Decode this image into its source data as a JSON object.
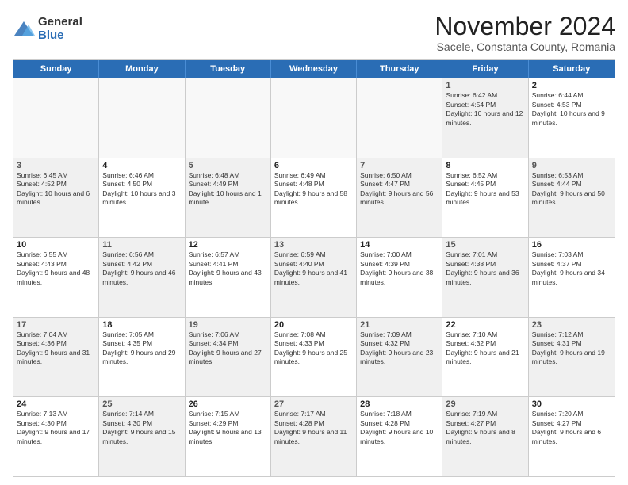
{
  "logo": {
    "general": "General",
    "blue": "Blue"
  },
  "header": {
    "month": "November 2024",
    "location": "Sacele, Constanta County, Romania"
  },
  "weekdays": [
    "Sunday",
    "Monday",
    "Tuesday",
    "Wednesday",
    "Thursday",
    "Friday",
    "Saturday"
  ],
  "rows": [
    [
      {
        "day": "",
        "text": "",
        "empty": true
      },
      {
        "day": "",
        "text": "",
        "empty": true
      },
      {
        "day": "",
        "text": "",
        "empty": true
      },
      {
        "day": "",
        "text": "",
        "empty": true
      },
      {
        "day": "",
        "text": "",
        "empty": true
      },
      {
        "day": "1",
        "text": "Sunrise: 6:42 AM\nSunset: 4:54 PM\nDaylight: 10 hours and 12 minutes.",
        "shaded": true
      },
      {
        "day": "2",
        "text": "Sunrise: 6:44 AM\nSunset: 4:53 PM\nDaylight: 10 hours and 9 minutes.",
        "shaded": false
      }
    ],
    [
      {
        "day": "3",
        "text": "Sunrise: 6:45 AM\nSunset: 4:52 PM\nDaylight: 10 hours and 6 minutes.",
        "shaded": true
      },
      {
        "day": "4",
        "text": "Sunrise: 6:46 AM\nSunset: 4:50 PM\nDaylight: 10 hours and 3 minutes.",
        "shaded": false
      },
      {
        "day": "5",
        "text": "Sunrise: 6:48 AM\nSunset: 4:49 PM\nDaylight: 10 hours and 1 minute.",
        "shaded": true
      },
      {
        "day": "6",
        "text": "Sunrise: 6:49 AM\nSunset: 4:48 PM\nDaylight: 9 hours and 58 minutes.",
        "shaded": false
      },
      {
        "day": "7",
        "text": "Sunrise: 6:50 AM\nSunset: 4:47 PM\nDaylight: 9 hours and 56 minutes.",
        "shaded": true
      },
      {
        "day": "8",
        "text": "Sunrise: 6:52 AM\nSunset: 4:45 PM\nDaylight: 9 hours and 53 minutes.",
        "shaded": false
      },
      {
        "day": "9",
        "text": "Sunrise: 6:53 AM\nSunset: 4:44 PM\nDaylight: 9 hours and 50 minutes.",
        "shaded": true
      }
    ],
    [
      {
        "day": "10",
        "text": "Sunrise: 6:55 AM\nSunset: 4:43 PM\nDaylight: 9 hours and 48 minutes.",
        "shaded": false
      },
      {
        "day": "11",
        "text": "Sunrise: 6:56 AM\nSunset: 4:42 PM\nDaylight: 9 hours and 46 minutes.",
        "shaded": true
      },
      {
        "day": "12",
        "text": "Sunrise: 6:57 AM\nSunset: 4:41 PM\nDaylight: 9 hours and 43 minutes.",
        "shaded": false
      },
      {
        "day": "13",
        "text": "Sunrise: 6:59 AM\nSunset: 4:40 PM\nDaylight: 9 hours and 41 minutes.",
        "shaded": true
      },
      {
        "day": "14",
        "text": "Sunrise: 7:00 AM\nSunset: 4:39 PM\nDaylight: 9 hours and 38 minutes.",
        "shaded": false
      },
      {
        "day": "15",
        "text": "Sunrise: 7:01 AM\nSunset: 4:38 PM\nDaylight: 9 hours and 36 minutes.",
        "shaded": true
      },
      {
        "day": "16",
        "text": "Sunrise: 7:03 AM\nSunset: 4:37 PM\nDaylight: 9 hours and 34 minutes.",
        "shaded": false
      }
    ],
    [
      {
        "day": "17",
        "text": "Sunrise: 7:04 AM\nSunset: 4:36 PM\nDaylight: 9 hours and 31 minutes.",
        "shaded": true
      },
      {
        "day": "18",
        "text": "Sunrise: 7:05 AM\nSunset: 4:35 PM\nDaylight: 9 hours and 29 minutes.",
        "shaded": false
      },
      {
        "day": "19",
        "text": "Sunrise: 7:06 AM\nSunset: 4:34 PM\nDaylight: 9 hours and 27 minutes.",
        "shaded": true
      },
      {
        "day": "20",
        "text": "Sunrise: 7:08 AM\nSunset: 4:33 PM\nDaylight: 9 hours and 25 minutes.",
        "shaded": false
      },
      {
        "day": "21",
        "text": "Sunrise: 7:09 AM\nSunset: 4:32 PM\nDaylight: 9 hours and 23 minutes.",
        "shaded": true
      },
      {
        "day": "22",
        "text": "Sunrise: 7:10 AM\nSunset: 4:32 PM\nDaylight: 9 hours and 21 minutes.",
        "shaded": false
      },
      {
        "day": "23",
        "text": "Sunrise: 7:12 AM\nSunset: 4:31 PM\nDaylight: 9 hours and 19 minutes.",
        "shaded": true
      }
    ],
    [
      {
        "day": "24",
        "text": "Sunrise: 7:13 AM\nSunset: 4:30 PM\nDaylight: 9 hours and 17 minutes.",
        "shaded": false
      },
      {
        "day": "25",
        "text": "Sunrise: 7:14 AM\nSunset: 4:30 PM\nDaylight: 9 hours and 15 minutes.",
        "shaded": true
      },
      {
        "day": "26",
        "text": "Sunrise: 7:15 AM\nSunset: 4:29 PM\nDaylight: 9 hours and 13 minutes.",
        "shaded": false
      },
      {
        "day": "27",
        "text": "Sunrise: 7:17 AM\nSunset: 4:28 PM\nDaylight: 9 hours and 11 minutes.",
        "shaded": true
      },
      {
        "day": "28",
        "text": "Sunrise: 7:18 AM\nSunset: 4:28 PM\nDaylight: 9 hours and 10 minutes.",
        "shaded": false
      },
      {
        "day": "29",
        "text": "Sunrise: 7:19 AM\nSunset: 4:27 PM\nDaylight: 9 hours and 8 minutes.",
        "shaded": true
      },
      {
        "day": "30",
        "text": "Sunrise: 7:20 AM\nSunset: 4:27 PM\nDaylight: 9 hours and 6 minutes.",
        "shaded": false
      }
    ]
  ]
}
